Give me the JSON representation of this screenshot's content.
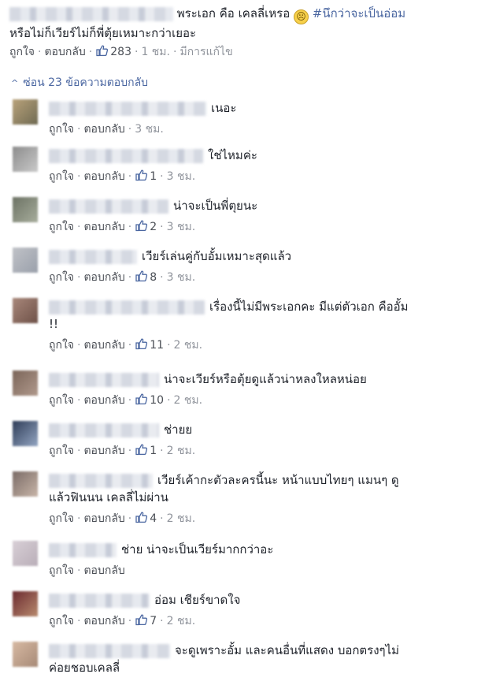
{
  "top_comment": {
    "text_pre": "พระเอก คือ เคลลี่เหรอ",
    "emoji": "🙁",
    "hashtag": "#นึกว่าจะเป็นอ่อม",
    "text_line2": "หรือไม่ก็เวียร์ไม่ก็พี่ตุ้ยเหมาะกว่าเยอะ",
    "like_label": "ถูกใจ",
    "reply_label": "ตอบกลับ",
    "like_count": "283",
    "time": "1 ชม.",
    "edited": "มีการแก้ไข"
  },
  "hide_replies_label": "ซ่อน 23 ข้อความตอบกลับ",
  "colors": {
    "link": "#4b67a1",
    "meta": "#90949c",
    "text": "#1d2129"
  },
  "replies": [
    {
      "text": "เนอะ",
      "like_label": "ถูกใจ",
      "reply_label": "ตอบกลับ",
      "likes": "",
      "time": "3 ชม."
    },
    {
      "text": "ใช่ไหมค่ะ",
      "like_label": "ถูกใจ",
      "reply_label": "ตอบกลับ",
      "likes": "1",
      "time": "3 ชม."
    },
    {
      "text": "น่าจะเป็นพี่ตุยนะ",
      "like_label": "ถูกใจ",
      "reply_label": "ตอบกลับ",
      "likes": "2",
      "time": "3 ชม."
    },
    {
      "text": "เวียร์เล่นคู่กับอั้มเหมาะสุดแล้ว",
      "like_label": "ถูกใจ",
      "reply_label": "ตอบกลับ",
      "likes": "8",
      "time": "3 ชม."
    },
    {
      "text": "เรื่องนี้ไม่มีพระเอกคะ มีแต่ตัวเอก คืออั้ม",
      "text_line2": "!!",
      "like_label": "ถูกใจ",
      "reply_label": "ตอบกลับ",
      "likes": "11",
      "time": "2 ชม."
    },
    {
      "text": "น่าจะเวียร์หรือตุ้ยดูแล้วน่าหลงใหลหน่อย",
      "like_label": "ถูกใจ",
      "reply_label": "ตอบกลับ",
      "likes": "10",
      "time": "2 ชม."
    },
    {
      "text": "ช่ายย",
      "like_label": "ถูกใจ",
      "reply_label": "ตอบกลับ",
      "likes": "1",
      "time": "2 ชม."
    },
    {
      "text": "เวียร์เค้ากะตัวละครนี้นะ หน้าแบบไทยๆ แมนๆ ดู",
      "text_line2": "แล้วฟินนน เคลลี่ไม่ผ่าน",
      "like_label": "ถูกใจ",
      "reply_label": "ตอบกลับ",
      "likes": "4",
      "time": "2 ชม."
    },
    {
      "text": "ช่าย น่าจะเป็นเวียร์มากกว่าอะ",
      "like_label": "ถูกใจ",
      "reply_label": "ตอบกลับ",
      "likes": "",
      "time": ""
    },
    {
      "text": "อ่อม เชียร์ขาดใจ",
      "like_label": "ถูกใจ",
      "reply_label": "ตอบกลับ",
      "likes": "7",
      "time": "2 ชม."
    },
    {
      "text": "จะดูเพราะอั้ม และคนอื่นที่แสดง บอกตรงๆไม่",
      "text_line2": "ค่อยชอบเคลลี่",
      "like_label": "",
      "reply_label": "",
      "likes": "",
      "time": ""
    }
  ]
}
